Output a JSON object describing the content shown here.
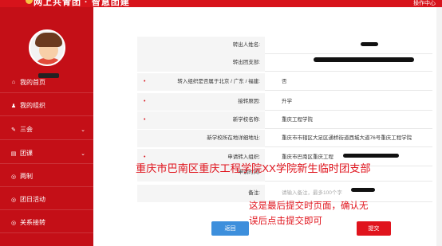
{
  "header": {
    "brand": "网上共青团 · 智慧团建",
    "right_label": "操作中心"
  },
  "sidebar": {
    "items": [
      {
        "icon": "home-icon",
        "glyph": "⌂",
        "label": "我的首页",
        "chevron": ""
      },
      {
        "icon": "users-icon",
        "glyph": "♟",
        "label": "我的组织",
        "chevron": ""
      },
      {
        "icon": "edit-icon",
        "glyph": "✎",
        "label": "三会",
        "chevron": "⌄"
      },
      {
        "icon": "book-icon",
        "glyph": "▤",
        "label": "团课",
        "chevron": "⌄"
      },
      {
        "icon": "target-icon",
        "glyph": "◎",
        "label": "两制",
        "chevron": ""
      },
      {
        "icon": "target-icon-2",
        "glyph": "◎",
        "label": "团日活动",
        "chevron": ""
      },
      {
        "icon": "transfer-icon",
        "glyph": "◎",
        "label": "关系接转",
        "chevron": ""
      }
    ]
  },
  "form": {
    "rows": [
      {
        "label": "转出人姓名:",
        "value": "",
        "required": ""
      },
      {
        "label": "转出团支部:",
        "value": "",
        "required": ""
      },
      {
        "label": "转入组织是否属于北京 / 广东 / 福建:",
        "value": "否",
        "required": "•"
      },
      {
        "label": "接转原因:",
        "value": "升学",
        "required": "•"
      },
      {
        "label": "新学校名称:",
        "value": "重庆工程学院",
        "required": "•"
      },
      {
        "label": "新学校所在地详细地址:",
        "value": "重庆市市辖区大足区通桥街道西城大道76号重庆工程学院",
        "required": ""
      },
      {
        "label": "申请转入组织:",
        "value": "重庆市巴南区重庆工程",
        "required": "•"
      },
      {
        "label": "申请时间:",
        "value": "",
        "required": ""
      },
      {
        "label": "备注:",
        "value": "请输入备注，最多100个字",
        "required": ""
      }
    ]
  },
  "annotations": {
    "overlay": "重庆市巴南区重庆工程学院XX学院新生临时团支部",
    "note_line1": "这是最后提交时页面，确认无",
    "note_line2": "误后点击提交即可"
  },
  "buttons": {
    "back": "返回",
    "submit": "提交"
  },
  "colors": {
    "brand_red": "#d7131b",
    "sidebar_red": "#c40f17",
    "back_blue": "#3d8fdc"
  }
}
